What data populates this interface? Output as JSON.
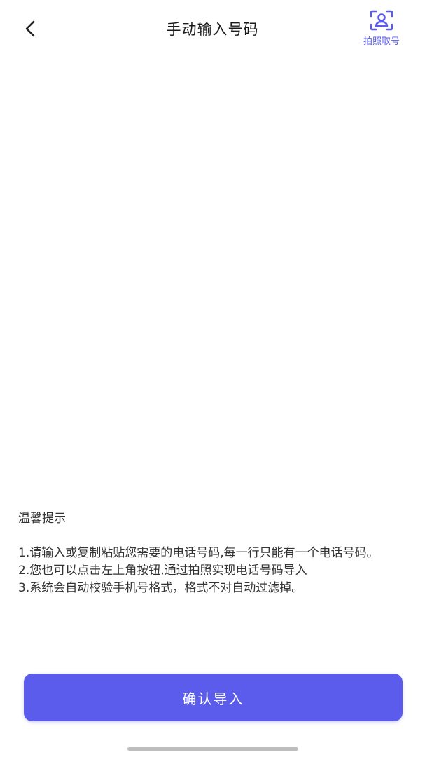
{
  "header": {
    "title": "手动输入号码",
    "back_icon": "chevron-left-icon",
    "photo_button": {
      "label": "拍照取号",
      "icon": "user-scan-icon"
    }
  },
  "input": {
    "value": "",
    "placeholder": ""
  },
  "tips": {
    "title": "温馨提示",
    "items": [
      " 1.请输入或复制粘贴您需要的电话号码,每一行只能有一个电话号码。",
      " 2.您也可以点击左上角按钮,通过拍照实现电话号码导入",
      " 3.系统会自动校验手机号格式，格式不对自动过滤掉。"
    ]
  },
  "confirm_button": {
    "label": "确认导入"
  },
  "colors": {
    "accent": "#5B5CEB",
    "text": "#333333",
    "background": "#FFFFFF"
  }
}
